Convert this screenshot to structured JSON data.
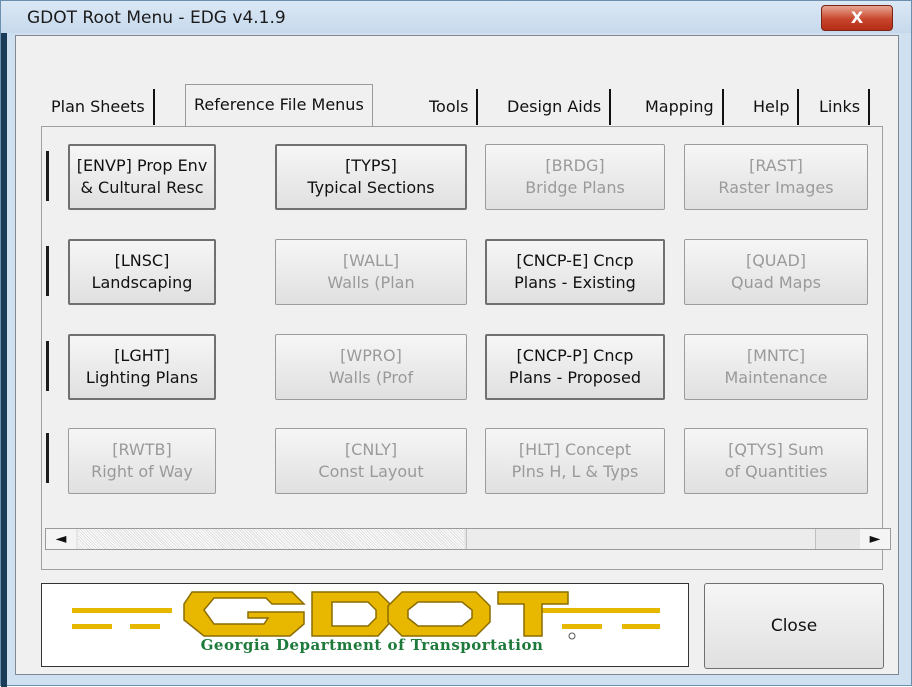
{
  "window": {
    "title": "GDOT Root Menu - EDG v4.1.9",
    "close_glyph": "X"
  },
  "tabs": [
    {
      "label": "Plan Sheets",
      "active": false
    },
    {
      "label": "Reference File Menus",
      "active": true
    },
    {
      "label": "Tools",
      "active": false
    },
    {
      "label": "Design Aids",
      "active": false
    },
    {
      "label": "Mapping",
      "active": false
    },
    {
      "label": "Help",
      "active": false
    },
    {
      "label": "Links",
      "active": false
    }
  ],
  "grid": [
    [
      {
        "line1": "[ENVP] Prop Env",
        "line2": "& Cultural Resc",
        "enabled": true
      },
      {
        "line1": "[TYPS]",
        "line2": "Typical Sections",
        "enabled": true
      },
      {
        "line1": "[BRDG]",
        "line2": "Bridge Plans",
        "enabled": false
      },
      {
        "line1": "[RAST]",
        "line2": "Raster Images",
        "enabled": false
      }
    ],
    [
      {
        "line1": "[LNSC]",
        "line2": "Landscaping",
        "enabled": true
      },
      {
        "line1": "[WALL]",
        "line2": "Walls (Plan",
        "enabled": false
      },
      {
        "line1": "[CNCP-E] Cncp",
        "line2": "Plans - Existing",
        "enabled": true
      },
      {
        "line1": "[QUAD]",
        "line2": "Quad Maps",
        "enabled": false
      }
    ],
    [
      {
        "line1": "[LGHT]",
        "line2": "Lighting Plans",
        "enabled": true
      },
      {
        "line1": "[WPRO]",
        "line2": "Walls (Prof",
        "enabled": false
      },
      {
        "line1": "[CNCP-P] Cncp",
        "line2": "Plans - Proposed",
        "enabled": true
      },
      {
        "line1": "[MNTC]",
        "line2": "Maintenance",
        "enabled": false
      }
    ],
    [
      {
        "line1": "[RWTB]",
        "line2": "Right of Way",
        "enabled": false
      },
      {
        "line1": "[CNLY]",
        "line2": "Const Layout",
        "enabled": false
      },
      {
        "line1": "[HLT] Concept",
        "line2": "Plns H, L & Typs",
        "enabled": false
      },
      {
        "line1": "[QTYS] Sum",
        "line2": "of Quantities",
        "enabled": false
      }
    ]
  ],
  "scrollbar": {
    "left_arrow": "◄",
    "right_arrow": "►"
  },
  "logo": {
    "wordmark": "GDOT",
    "tagline": "Georgia Department of Transportation"
  },
  "footer": {
    "close_label": "Close"
  },
  "colors": {
    "logo_gold": "#e8b800",
    "logo_green": "#1d7a3a",
    "close_red": "#c8452c"
  }
}
